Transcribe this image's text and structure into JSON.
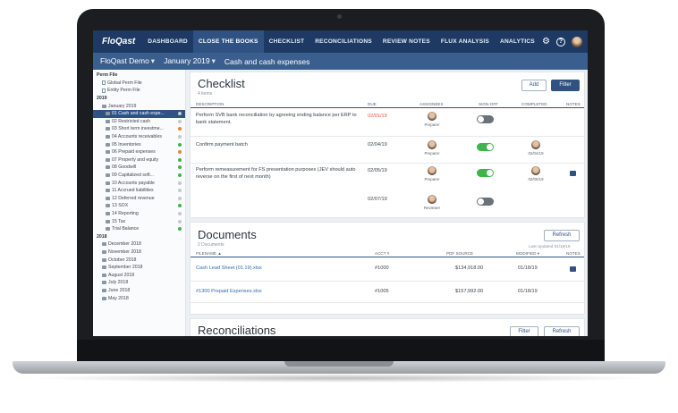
{
  "nav": {
    "logo": "FloQast",
    "tabs": [
      "DASHBOARD",
      "CLOSE THE BOOKS",
      "CHECKLIST",
      "RECONCILIATIONS",
      "REVIEW NOTES",
      "FLUX ANALYSIS",
      "ANALYTICS"
    ],
    "active_tab": "CLOSE THE BOOKS"
  },
  "subheader": {
    "company": "FloQast Demo",
    "period": "January 2019",
    "section": "Cash and cash expenses"
  },
  "sidebar": {
    "items": [
      {
        "label": "Perm File",
        "level": 0,
        "type": "section"
      },
      {
        "label": "Global Perm File",
        "level": 1,
        "type": "file"
      },
      {
        "label": "Entity Perm File",
        "level": 1,
        "type": "file"
      },
      {
        "label": "2019",
        "level": 0,
        "type": "section"
      },
      {
        "label": "January 2019",
        "level": 1,
        "type": "folder"
      },
      {
        "label": "01 Cash and cash expe...",
        "level": 2,
        "type": "folder",
        "active": true,
        "status": "gray"
      },
      {
        "label": "02 Restricted cash",
        "level": 2,
        "type": "folder",
        "status": "gray"
      },
      {
        "label": "03 Short term investme...",
        "level": 2,
        "type": "folder",
        "status": "orange"
      },
      {
        "label": "04 Accounts receivables",
        "level": 2,
        "type": "folder",
        "status": "gray"
      },
      {
        "label": "05 Inventories",
        "level": 2,
        "type": "folder",
        "status": "green"
      },
      {
        "label": "06 Prepaid expenses",
        "level": 2,
        "type": "folder",
        "status": "orange"
      },
      {
        "label": "07 Property and equity",
        "level": 2,
        "type": "folder",
        "status": "green"
      },
      {
        "label": "08 Goodwill",
        "level": 2,
        "type": "folder",
        "status": "green"
      },
      {
        "label": "09 Capitalized soft...",
        "level": 2,
        "type": "folder",
        "status": "green"
      },
      {
        "label": "10 Accounts payable",
        "level": 2,
        "type": "folder",
        "status": "gray"
      },
      {
        "label": "11 Accrued liabilities",
        "level": 2,
        "type": "folder",
        "status": "gray"
      },
      {
        "label": "12 Deferred revenue",
        "level": 2,
        "type": "folder",
        "status": "gray"
      },
      {
        "label": "13 SOX",
        "level": 2,
        "type": "folder",
        "status": "green"
      },
      {
        "label": "14 Reporting",
        "level": 2,
        "type": "folder",
        "status": "gray"
      },
      {
        "label": "15 Tax",
        "level": 2,
        "type": "folder",
        "status": "gray"
      },
      {
        "label": "Trial Balance",
        "level": 2,
        "type": "folder",
        "status": "green"
      },
      {
        "label": "2018",
        "level": 0,
        "type": "section"
      },
      {
        "label": "December 2018",
        "level": 1,
        "type": "folder"
      },
      {
        "label": "November 2018",
        "level": 1,
        "type": "folder"
      },
      {
        "label": "October 2018",
        "level": 1,
        "type": "folder"
      },
      {
        "label": "September 2018",
        "level": 1,
        "type": "folder"
      },
      {
        "label": "August 2018",
        "level": 1,
        "type": "folder"
      },
      {
        "label": "July 2018",
        "level": 1,
        "type": "folder"
      },
      {
        "label": "June 2018",
        "level": 1,
        "type": "folder"
      },
      {
        "label": "May 2018",
        "level": 1,
        "type": "folder"
      }
    ]
  },
  "checklist": {
    "title": "Checklist",
    "subtitle": "4 items",
    "add_label": "Add",
    "filter_label": "Filter",
    "columns": [
      "DESCRIPTION",
      "DUE",
      "ASSIGNEES",
      "SIGN-OFF",
      "COMPLETED",
      "NOTES"
    ],
    "rows": [
      {
        "description": "Perform SVB bank reconciliation by agreeing ending balance per ERP to bank statement.",
        "due": "02/01/19",
        "overdue": true,
        "assignee": "Preparer",
        "signoff": "off",
        "completed": "",
        "note": false
      },
      {
        "description": "Confirm payment batch",
        "due": "02/04/19",
        "overdue": false,
        "assignee": "Preparer",
        "signoff": "on",
        "completed": "02/04/19",
        "note": false
      },
      {
        "description": "Perform remeasurement for FS presentation purposes (JEV should auto reverse on the first of next month)",
        "due": "02/05/19",
        "overdue": false,
        "assignee": "Preparer",
        "signoff": "on",
        "completed": "02/05/19",
        "note": true
      },
      {
        "description": "",
        "due": "02/07/19",
        "overdue": false,
        "assignee": "Reviewer",
        "signoff": "off",
        "completed": "",
        "note": false
      }
    ]
  },
  "documents": {
    "title": "Documents",
    "subtitle": "2 Documents",
    "refresh_label": "Refresh",
    "last_updated": "Last Updated 01/18/19",
    "columns": [
      "FILENAME ▲",
      "ACCT #",
      "PDF SOURCE",
      "MODIFIED ▾",
      "NOTES"
    ],
    "rows": [
      {
        "filename": "Cash Lead Sheet (01.19).xlsx",
        "acct": "#1000",
        "source": "$134,918.00",
        "modified": "01/18/19",
        "note": true
      },
      {
        "filename": "#1300 Prepaid Expenses.xlsx",
        "acct": "#1005",
        "source": "$157,992.00",
        "modified": "01/18/19",
        "note": false
      }
    ]
  },
  "reconciliations": {
    "title": "Reconciliations",
    "filter_label": "Filter",
    "refresh_label": "Refresh"
  },
  "colors": {
    "nav_bg": "#1e3a64",
    "subheader_bg": "#3a5f8f",
    "accent": "#2f5283",
    "green": "#3db54a",
    "orange": "#f0822b"
  }
}
